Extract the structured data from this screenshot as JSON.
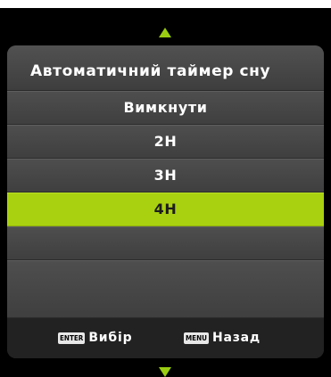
{
  "menu": {
    "title": "Автоматичний таймер сну",
    "options": [
      {
        "label": "Вимкнути",
        "selected": false
      },
      {
        "label": "2H",
        "selected": false
      },
      {
        "label": "3H",
        "selected": false
      },
      {
        "label": "4H",
        "selected": true
      },
      {
        "label": "",
        "selected": false
      },
      {
        "label": "",
        "selected": false
      }
    ]
  },
  "footer": {
    "enter_key": "ENTER",
    "enter_label": "Вибір",
    "menu_key": "MENU",
    "menu_label": "Назад"
  },
  "colors": {
    "accent": "#a9d10f",
    "panel": "#3d3d3d",
    "background": "#000000"
  },
  "icons": {
    "scroll_up": "triangle-up-icon",
    "scroll_down": "triangle-down-icon"
  }
}
